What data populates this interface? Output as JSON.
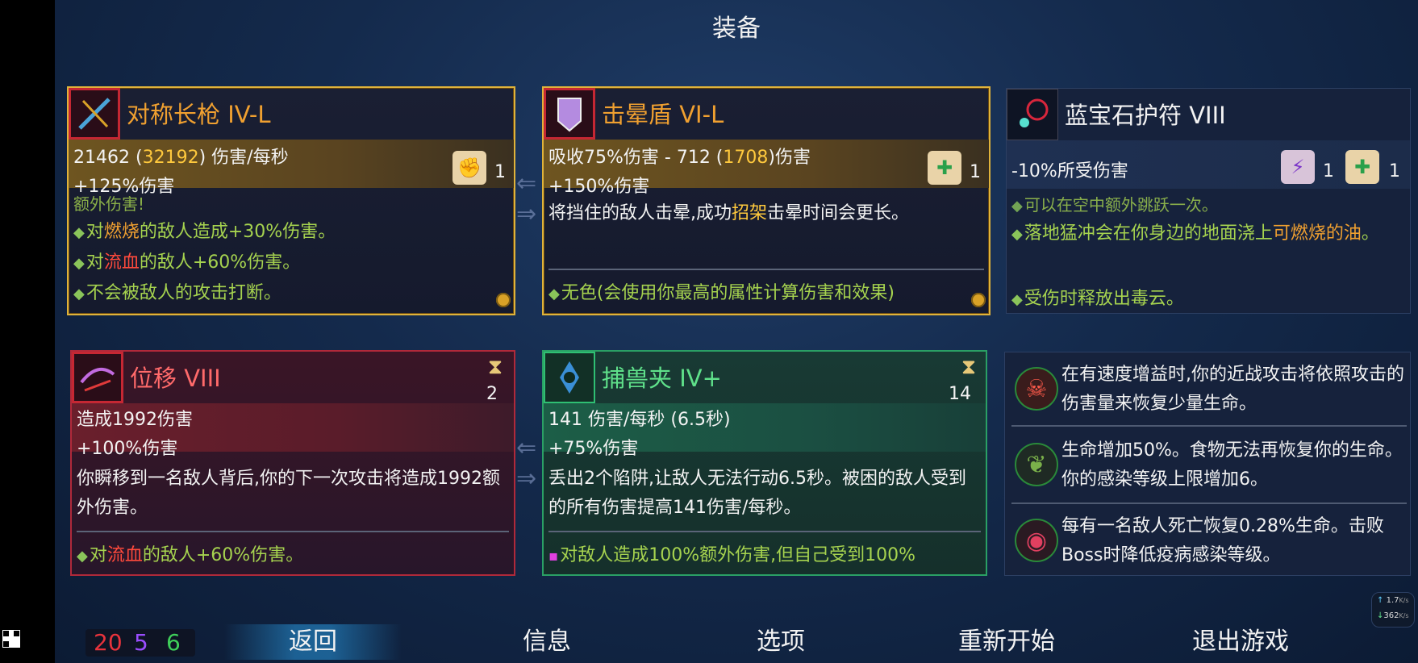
{
  "title": "装备",
  "weapon1": {
    "name": "对称长枪 IV-L",
    "stat_main": "21462",
    "stat_paren": "32192",
    "stat_unit": "伤害/每秒",
    "stat2": "+125%伤害",
    "scroll_count": "1",
    "cut_text": "额外伤害!",
    "bullets": [
      {
        "pre": "对",
        "hl": "燃烧",
        "post": "的敌人造成+30%伤害。"
      },
      {
        "pre": "对",
        "hl": "流血",
        "post": "的敌人+60%伤害。"
      },
      {
        "pre": "",
        "hl": "",
        "post": "不会被敌人的攻击打断。"
      }
    ]
  },
  "shield": {
    "name": "击晕盾 VI-L",
    "stat_pre": "吸收75%伤害  -  712 (",
    "stat_hl": "1708",
    "stat_post": ")伤害",
    "stat2": "+150%伤害",
    "scroll_count": "1",
    "desc_pre": "将挡住的敌人击晕,成功",
    "desc_hl": "招架",
    "desc_post": "击晕时间会更长。",
    "bullet": "无色(会使用你最高的属性计算伤害和效果)"
  },
  "amulet": {
    "name": "蓝宝石护符 VIII",
    "stat": "-10%所受伤害",
    "scroll1_count": "1",
    "scroll2_count": "1",
    "cut_text": "可以在空中额外跳跃一次。",
    "bullet1_pre": "落地猛冲会在你身边的地面浇上",
    "bullet1_hl": "可燃烧的油",
    "bullet1_post": "。",
    "bullet2": "受伤时释放出毒云。"
  },
  "skill1": {
    "name": "位移 VIII",
    "cooldown": "2",
    "stat1": "造成1992伤害",
    "stat2": "+100%伤害",
    "desc": "你瞬移到一名敌人背后,你的下一次攻击将造成1992额外伤害。",
    "bullet_pre": "对",
    "bullet_hl": "流血",
    "bullet_post": "的敌人+60%伤害。"
  },
  "skill2": {
    "name": "捕兽夹 IV+",
    "cooldown": "14",
    "stat1": "141 伤害/每秒 (6.5秒)",
    "stat2": "+75%伤害",
    "desc": "丢出2个陷阱,让敌人无法行动6.5秒。被困的敌人受到的所有伤害提高141伤害/每秒。",
    "bullet": "对敌人造成100%额外伤害,但自己受到100%"
  },
  "mutations": [
    {
      "icon": "skull-mutation-icon",
      "text": "在有速度增益时,你的近战攻击将依照攻击的伤害量来恢复少量生命。"
    },
    {
      "icon": "leaf-mutation-icon",
      "text": "生命增加50%。食物无法再恢复你的生命。你的感染等级上限增加6。"
    },
    {
      "icon": "fangs-mutation-icon",
      "text": "每有一名敌人死亡恢复0.28%生命。击败Boss时降低疫病感染等级。"
    }
  ],
  "network": {
    "up": "1.7",
    "up_unit": "K/s",
    "down": "362",
    "down_unit": "K/s"
  },
  "scrolls": {
    "brutality": "20",
    "tactics": "5",
    "survival": "6"
  },
  "menu": {
    "back": "返回",
    "info": "信息",
    "options": "选项",
    "restart": "重新开始",
    "quit": "退出游戏"
  },
  "colors": {
    "gold_border": "#e0b33a",
    "red_border": "#b0293a",
    "green_border": "#2aa065",
    "brutality": "#e8333c",
    "tactics": "#9a4dff",
    "survival": "#3fcf5a"
  }
}
